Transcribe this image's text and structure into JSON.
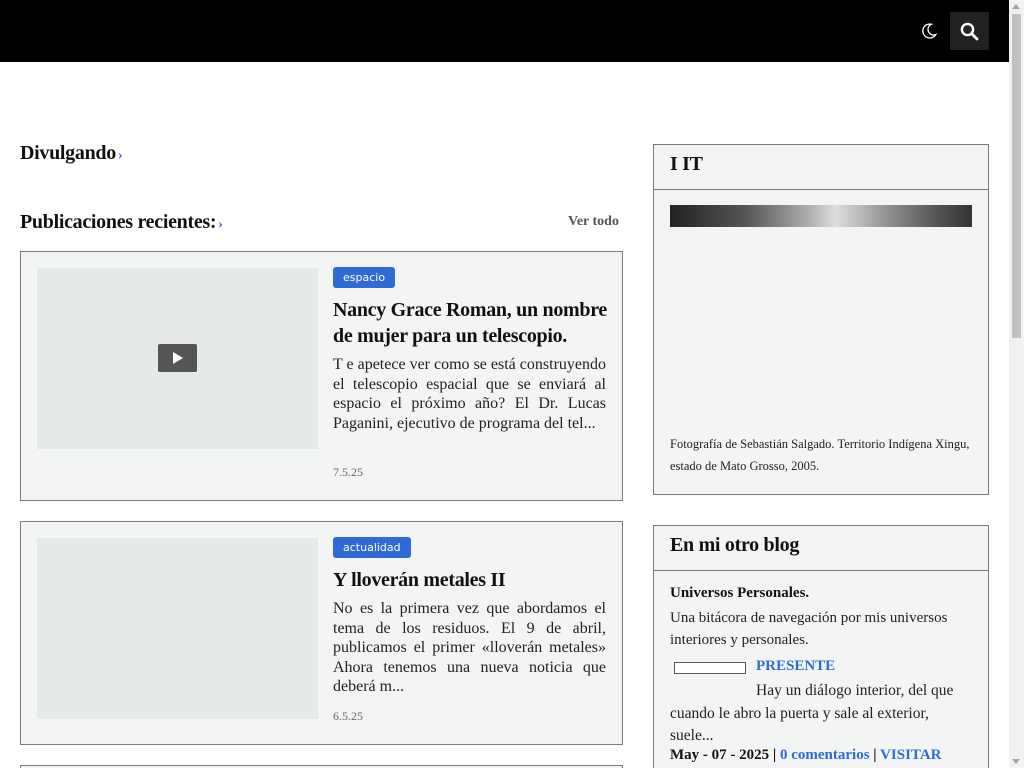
{
  "header": {
    "theme_toggle_icon": "moon-icon",
    "search_icon": "search-icon",
    "background": "#000000"
  },
  "main": {
    "section_title": "Divulgando",
    "recent_title": "Publicaciones recientes:",
    "see_all": "Ver todo",
    "posts": [
      {
        "tag": "espacio",
        "title": "Nancy Grace Roman, un nombre de mujer para un telescopio.",
        "excerpt": "T e apetece ver como se está construyendo el telescopio espacial que se enviará al espacio el próximo año? El Dr. Lucas Paganini, ejecutivo de programa del tel...",
        "date": "7.5.25",
        "has_video": true
      },
      {
        "tag": "actualidad",
        "title": "Y lloverán metales II",
        "excerpt": "No es la primera vez que abordamos el tema de los residuos. El 9 de abril, publicamos el primer «lloverán metales» Ahora tenemos una nueva noticia que deberá m...",
        "date": "6.5.25",
        "has_video": false
      }
    ]
  },
  "sidebar": {
    "widget1": {
      "title": "I  IT",
      "caption": "Fotografía de Sebastián Salgado. Territorio Indígena Xingu, estado de Mato Grosso, 2005."
    },
    "widget2": {
      "title": "En mi otro blog",
      "blog_name": "Universos Personales.",
      "blog_description": "Una bitácora de navegación por mis universos interiores y personales.",
      "post_title": "PRESENTE",
      "post_excerpt": "Hay un diálogo interior, del que cuando le abro la puerta y sale al exterior, suele...",
      "post_date": "May - 07 - 2025",
      "comments": "0 comentarios",
      "visit": "VISITAR"
    }
  },
  "colors": {
    "accent": "#2e6bd6",
    "card_bg": "#f3f4f4"
  }
}
